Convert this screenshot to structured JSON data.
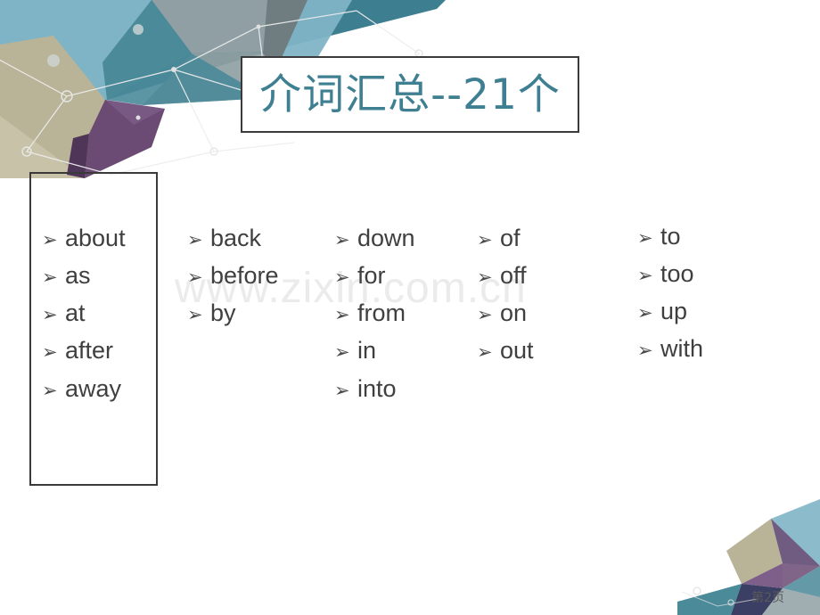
{
  "slide": {
    "title": "介词汇总--21个",
    "title_color": "#3f7f92",
    "watermark": "www.zixin.com.cn",
    "page_number": "第2页",
    "bullet_glyph": "➢",
    "text_color": "#3f3f3f",
    "border_color": "#3a3a3a"
  },
  "columns": [
    {
      "name": "column-1-boxed",
      "boxed": true,
      "words": [
        "about",
        "as",
        "at",
        "after",
        "away"
      ]
    },
    {
      "name": "column-2",
      "boxed": false,
      "words": [
        "back",
        "before",
        "by"
      ]
    },
    {
      "name": "column-3",
      "boxed": false,
      "words": [
        "down",
        "for",
        "from",
        "in",
        "into"
      ]
    },
    {
      "name": "column-4",
      "boxed": false,
      "words": [
        "of",
        "off",
        "on",
        "out"
      ]
    },
    {
      "name": "column-5",
      "boxed": false,
      "words": [
        "to",
        "too",
        "up",
        "with"
      ]
    }
  ],
  "decoration": {
    "palette": {
      "teal_dark": "#3d7f91",
      "teal_mid": "#4a8a99",
      "blue_light": "#7fb4c6",
      "gray_blue": "#8f9fa3",
      "gray_dark": "#6f7d80",
      "purple": "#6b4a73",
      "purple_dark": "#4f3557",
      "purple_mid": "#7d5f8a",
      "khaki": "#b9b498",
      "khaki_light": "#c8c3a8",
      "navy": "#3b3f63",
      "line": "#ededed"
    }
  }
}
